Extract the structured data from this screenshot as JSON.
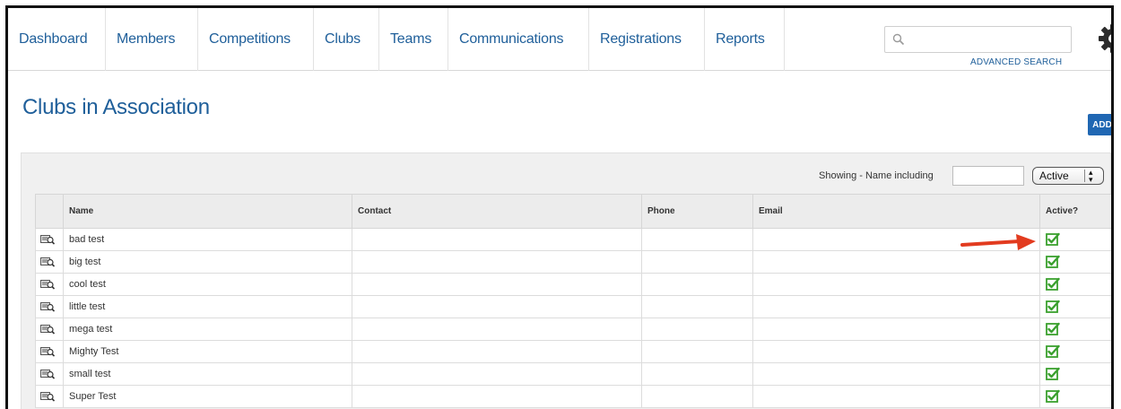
{
  "nav": {
    "items": [
      {
        "label": "Dashboard",
        "name": "nav-dashboard"
      },
      {
        "label": "Members",
        "name": "nav-members"
      },
      {
        "label": "Competitions",
        "name": "nav-competitions"
      },
      {
        "label": "Clubs",
        "name": "nav-clubs"
      },
      {
        "label": "Teams",
        "name": "nav-teams"
      },
      {
        "label": "Communications",
        "name": "nav-communications"
      },
      {
        "label": "Registrations",
        "name": "nav-registrations"
      },
      {
        "label": "Reports",
        "name": "nav-reports"
      }
    ],
    "search_value": "",
    "advanced_search": "ADVANCED SEARCH"
  },
  "page": {
    "title": "Clubs in Association",
    "add_label": "ADD"
  },
  "filter": {
    "label": "Showing - Name including",
    "value": "",
    "status_selected": "Active"
  },
  "table": {
    "columns": [
      "Name",
      "Contact",
      "Phone",
      "Email",
      "Active?"
    ],
    "rows": [
      {
        "name": "bad test",
        "contact": "",
        "phone": "",
        "email": "",
        "active": true
      },
      {
        "name": "big test",
        "contact": "",
        "phone": "",
        "email": "",
        "active": true
      },
      {
        "name": "cool test",
        "contact": "",
        "phone": "",
        "email": "",
        "active": true
      },
      {
        "name": "little test",
        "contact": "",
        "phone": "",
        "email": "",
        "active": true
      },
      {
        "name": "mega test",
        "contact": "",
        "phone": "",
        "email": "",
        "active": true
      },
      {
        "name": "Mighty Test",
        "contact": "",
        "phone": "",
        "email": "",
        "active": true
      },
      {
        "name": "small test",
        "contact": "",
        "phone": "",
        "email": "",
        "active": true
      },
      {
        "name": "Super Test",
        "contact": "",
        "phone": "",
        "email": "",
        "active": true
      }
    ]
  },
  "colors": {
    "link": "#1f5f9a",
    "add_button": "#2067b3",
    "check": "#3aa02e",
    "arrow": "#e23b1f"
  },
  "icons": {
    "search": "search-icon",
    "settings": "gear-icon",
    "row": "view-details-icon",
    "active": "checkbox-checked-icon",
    "pointer": "red-arrow-icon"
  }
}
